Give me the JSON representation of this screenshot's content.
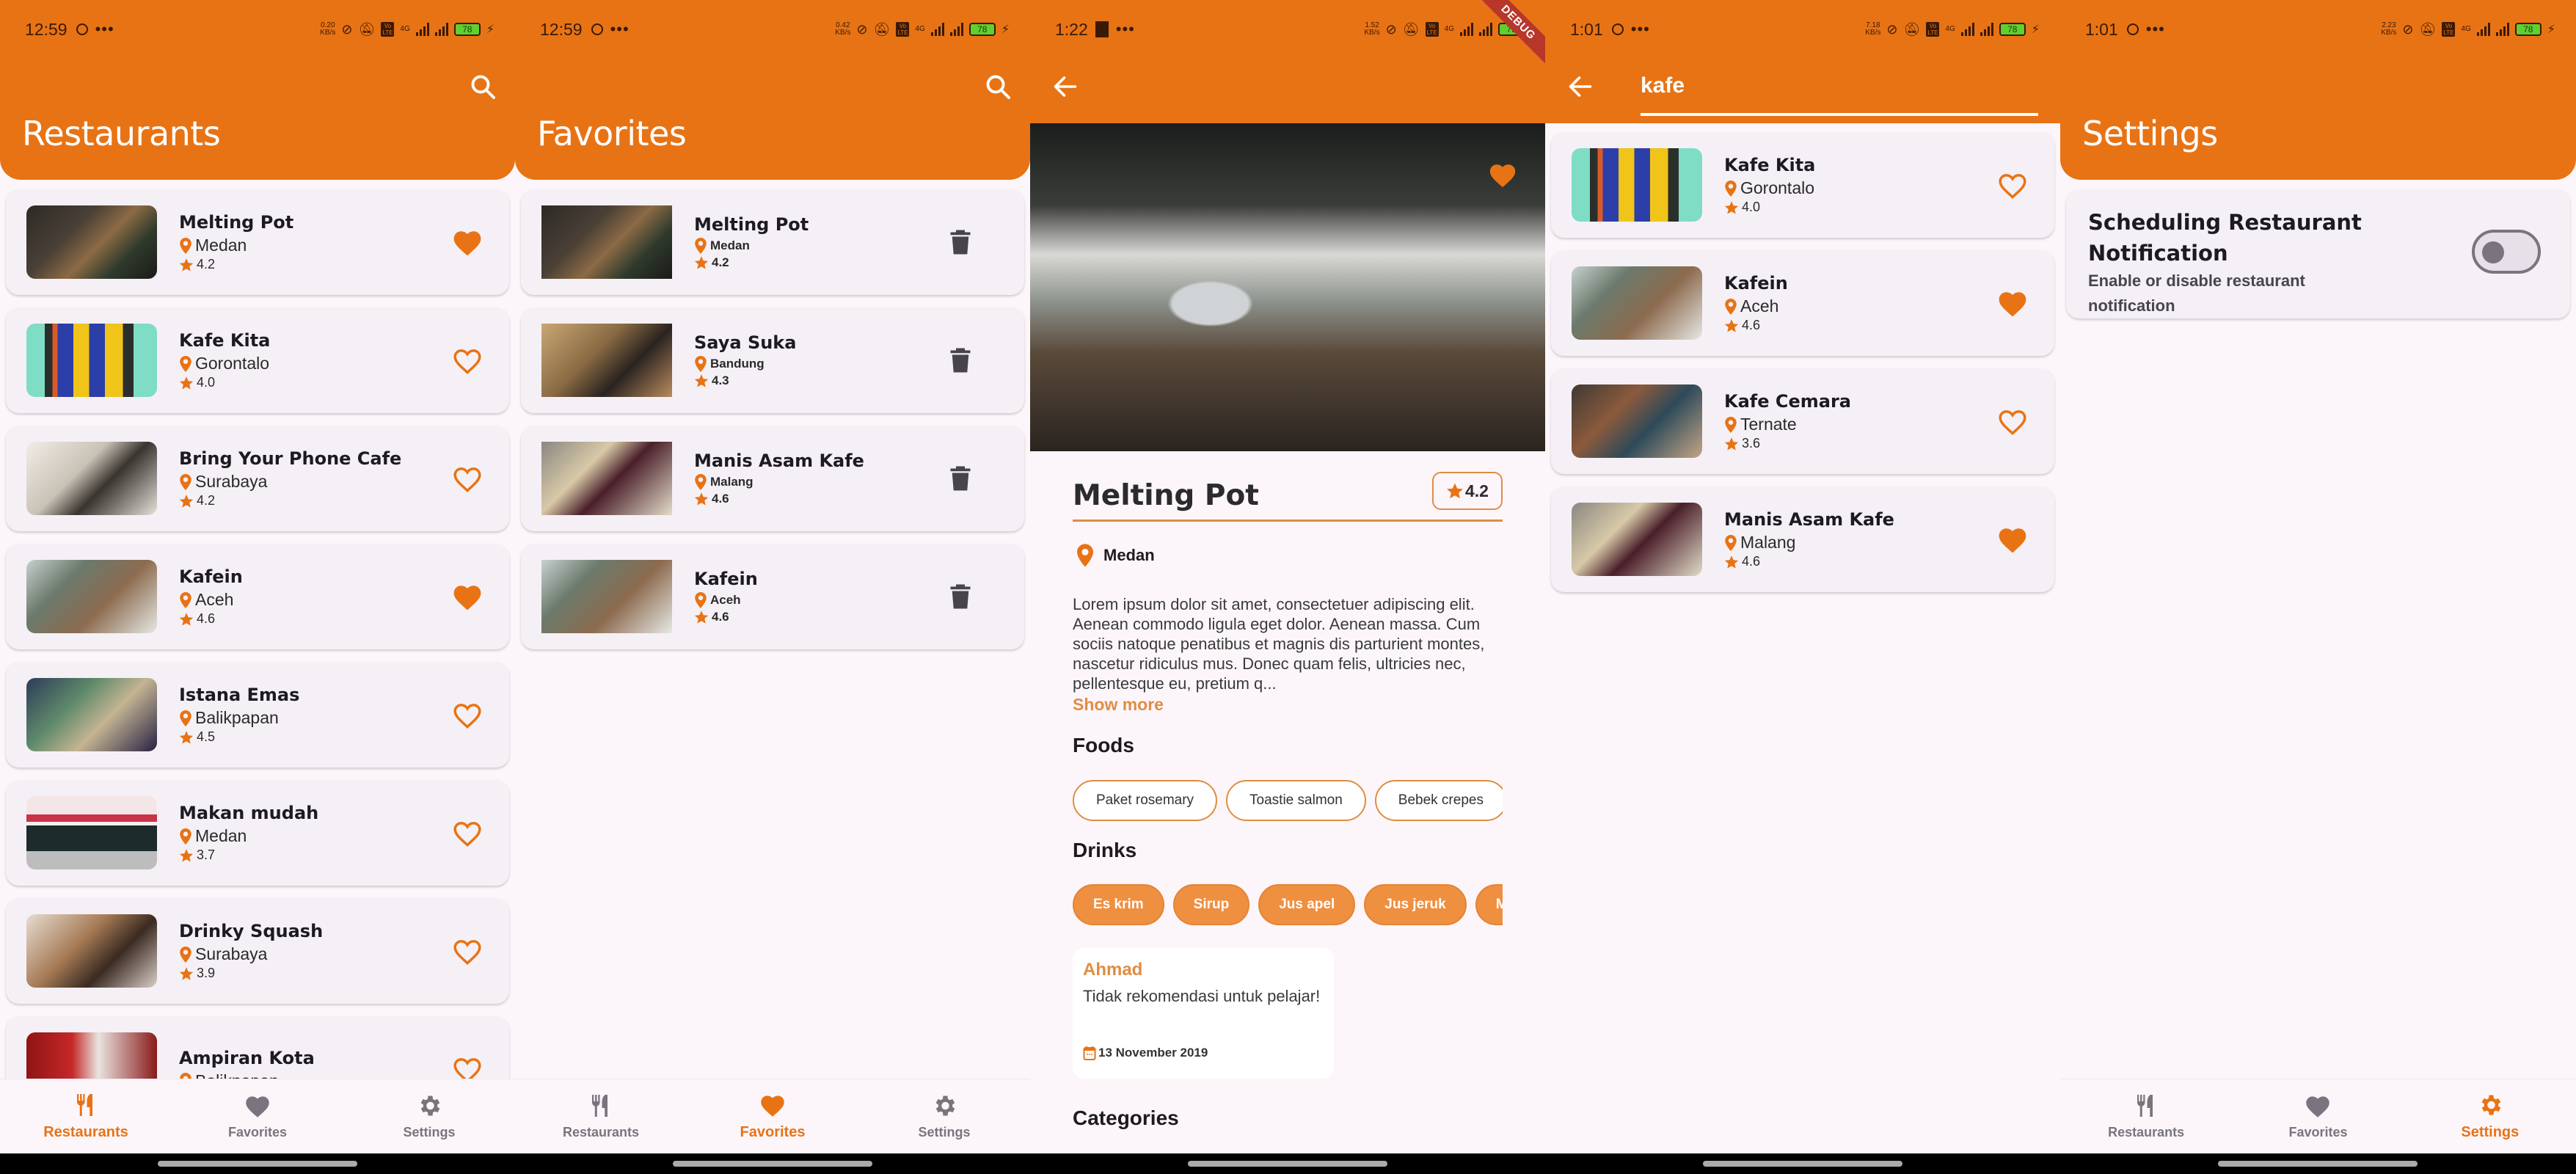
{
  "colors": {
    "primary": "#e87314",
    "accent_light": "#e08d42",
    "nav_inactive": "#79747e",
    "card_bg": "#f5f0f6",
    "screen_bg": "#fcf6fb"
  },
  "nav_labels": [
    "Restaurants",
    "Favorites",
    "Settings"
  ],
  "screens": {
    "restaurants": {
      "status": {
        "time": "12:59",
        "net_speed": "0.20",
        "net_unit": "KB/s",
        "network": "4G",
        "battery": "78"
      },
      "title": "Restaurants",
      "search_icon": "search-icon",
      "items": [
        {
          "name": "Melting Pot",
          "city": "Medan",
          "rating": "4.2",
          "favorite": true
        },
        {
          "name": "Kafe Kita",
          "city": "Gorontalo",
          "rating": "4.0",
          "favorite": false
        },
        {
          "name": "Bring Your Phone Cafe",
          "city": "Surabaya",
          "rating": "4.2",
          "favorite": false
        },
        {
          "name": "Kafein",
          "city": "Aceh",
          "rating": "4.6",
          "favorite": true
        },
        {
          "name": "Istana Emas",
          "city": "Balikpapan",
          "rating": "4.5",
          "favorite": false
        },
        {
          "name": "Makan mudah",
          "city": "Medan",
          "rating": "3.7",
          "favorite": false
        },
        {
          "name": "Drinky Squash",
          "city": "Surabaya",
          "rating": "3.9",
          "favorite": false
        },
        {
          "name": "Ampiran Kota",
          "city": "Balikpapan",
          "rating": "",
          "favorite": false
        }
      ],
      "active_tab": 0
    },
    "favorites": {
      "status": {
        "time": "12:59",
        "net_speed": "0.42",
        "net_unit": "KB/s",
        "network": "4G",
        "battery": "78"
      },
      "title": "Favorites",
      "items": [
        {
          "name": "Melting Pot",
          "city": "Medan",
          "rating": "4.2"
        },
        {
          "name": "Saya Suka",
          "city": "Bandung",
          "rating": "4.3"
        },
        {
          "name": "Manis Asam Kafe",
          "city": "Malang",
          "rating": "4.6"
        },
        {
          "name": "Kafein",
          "city": "Aceh",
          "rating": "4.6"
        }
      ],
      "active_tab": 1
    },
    "detail": {
      "status": {
        "time": "1:22",
        "net_speed": "1.52",
        "net_unit": "KB/s",
        "network": "4G",
        "battery": "79"
      },
      "debug_banner": "DEBUG",
      "name": "Melting Pot",
      "rating": "4.2",
      "city": "Medan",
      "favorite": true,
      "description": "Lorem ipsum dolor sit amet, consectetuer adipiscing elit. Aenean commodo ligula eget dolor. Aenean massa. Cum sociis natoque penatibus et magnis dis parturient montes, nascetur ridiculus mus. Donec quam felis, ultricies nec, pellentesque eu, pretium q...",
      "show_more": "Show more",
      "foods_title": "Foods",
      "foods": [
        "Paket rosemary",
        "Toastie salmon",
        "Bebek crepes"
      ],
      "drinks_title": "Drinks",
      "drinks": [
        "Es krim",
        "Sirup",
        "Jus apel",
        "Jus jeruk",
        "Minuman"
      ],
      "review": {
        "name": "Ahmad",
        "text": "Tidak rekomendasi untuk pelajar!",
        "date": "13 November 2019"
      },
      "categories_title": "Categories"
    },
    "search": {
      "status": {
        "time": "1:01",
        "net_speed": "7.18",
        "net_unit": "KB/s",
        "network": "4G",
        "battery": "78"
      },
      "query": "kafe",
      "items": [
        {
          "name": "Kafe Kita",
          "city": "Gorontalo",
          "rating": "4.0",
          "favorite": false
        },
        {
          "name": "Kafein",
          "city": "Aceh",
          "rating": "4.6",
          "favorite": true
        },
        {
          "name": "Kafe Cemara",
          "city": "Ternate",
          "rating": "3.6",
          "favorite": false
        },
        {
          "name": "Manis Asam Kafe",
          "city": "Malang",
          "rating": "4.6",
          "favorite": true
        }
      ]
    },
    "settings": {
      "status": {
        "time": "1:01",
        "net_speed": "2.23",
        "net_unit": "KB/s",
        "network": "4G",
        "battery": "78"
      },
      "title": "Settings",
      "option_title": "Scheduling Restaurant Notification",
      "option_subtitle": "Enable or disable restaurant notification",
      "toggle_on": false,
      "active_tab": 2
    }
  }
}
